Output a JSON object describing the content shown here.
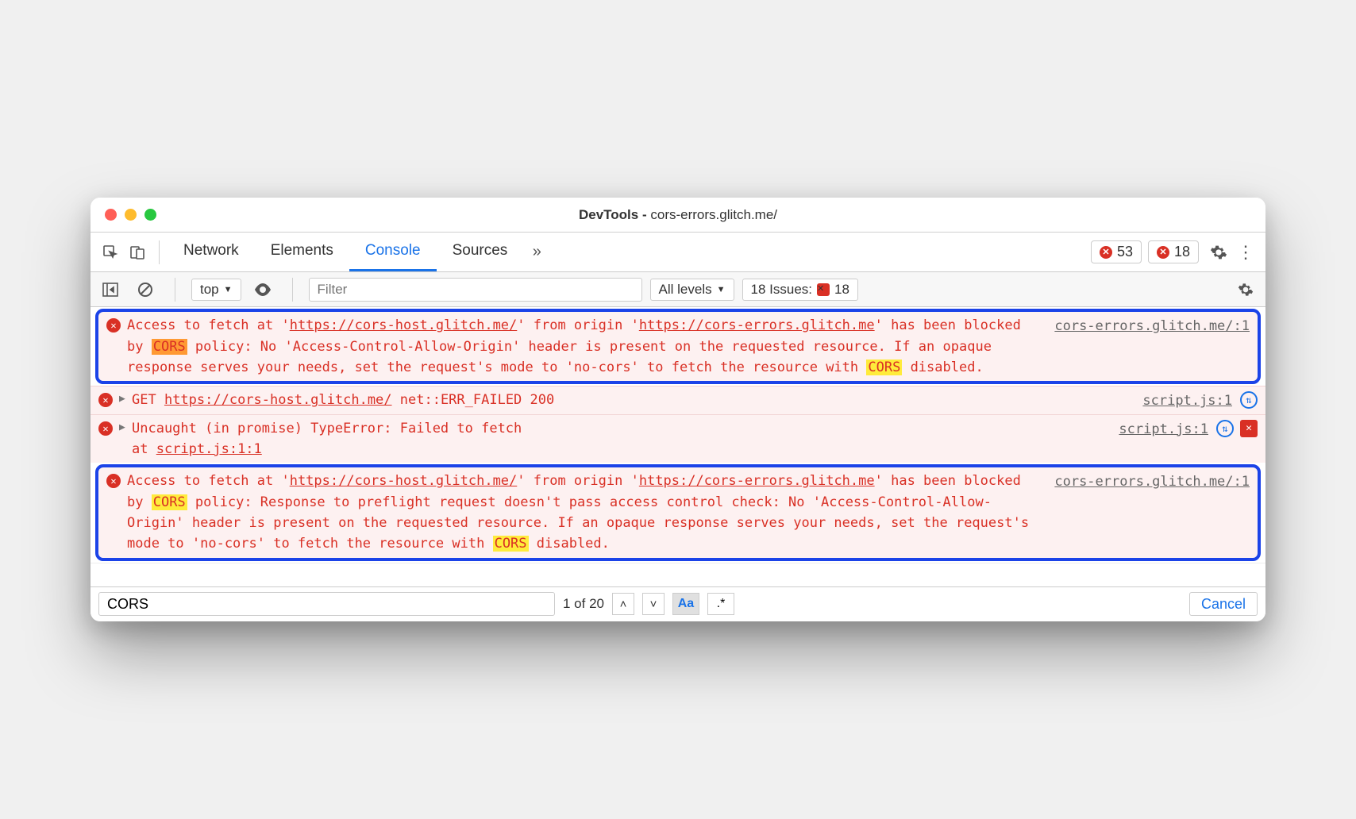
{
  "window": {
    "title_prefix": "DevTools - ",
    "title_url": "cors-errors.glitch.me/"
  },
  "tabs": {
    "items": [
      "Network",
      "Elements",
      "Console",
      "Sources"
    ],
    "active": "Console"
  },
  "counters": {
    "errors": "53",
    "issues": "18"
  },
  "toolbar": {
    "context": "top",
    "filter_placeholder": "Filter",
    "levels": "All levels",
    "issues_label": "18 Issues:",
    "issues_count": "18"
  },
  "messages": [
    {
      "boxed": true,
      "source": "cors-errors.glitch.me/:1",
      "segments": [
        {
          "t": "Access to fetch at '"
        },
        {
          "t": "https://cors-host.glitch.me/",
          "u": 1
        },
        {
          "t": "' from origin '"
        },
        {
          "t": "https://cors-errors.glitch.me",
          "u": 1
        },
        {
          "t": "' has been blocked by "
        },
        {
          "t": "CORS",
          "hl": "o"
        },
        {
          "t": " policy: No 'Access-Control-Allow-Origin' header is present on the requested resource. If an opaque response serves your needs, set the request's mode to 'no-cors' to fetch the resource with "
        },
        {
          "t": "CORS",
          "hl": "y"
        },
        {
          "t": " disabled."
        }
      ]
    },
    {
      "boxed": false,
      "expand": true,
      "source": "script.js:1",
      "icons": [
        "reload"
      ],
      "segments": [
        {
          "t": "GET "
        },
        {
          "t": "https://cors-host.glitch.me/",
          "u": 1
        },
        {
          "t": " net::ERR_FAILED 200"
        }
      ]
    },
    {
      "boxed": false,
      "expand": true,
      "source": "script.js:1",
      "icons": [
        "reload",
        "issue"
      ],
      "segments": [
        {
          "t": "Uncaught (in promise) TypeError: Failed to fetch"
        }
      ],
      "stack": [
        {
          "t": "    at "
        },
        {
          "t": "script.js:1:1",
          "u": 1
        }
      ]
    },
    {
      "boxed": true,
      "source": "cors-errors.glitch.me/:1",
      "segments": [
        {
          "t": "Access to fetch at '"
        },
        {
          "t": "https://cors-host.glitch.me/",
          "u": 1
        },
        {
          "t": "' from origin '"
        },
        {
          "t": "https://cors-errors.glitch.me",
          "u": 1
        },
        {
          "t": "' has been blocked by "
        },
        {
          "t": "CORS",
          "hl": "y"
        },
        {
          "t": " policy: Response to preflight request doesn't pass access control check: No 'Access-Control-Allow-Origin' header is present on the requested resource. If an opaque response serves your needs, set the request's mode to 'no-cors' to fetch the resource with "
        },
        {
          "t": "CORS",
          "hl": "y"
        },
        {
          "t": " disabled."
        }
      ]
    }
  ],
  "find": {
    "value": "CORS",
    "count": "1 of 20",
    "case_on": true,
    "regex_on": false,
    "case_label": "Aa",
    "regex_label": ".*",
    "cancel": "Cancel"
  }
}
